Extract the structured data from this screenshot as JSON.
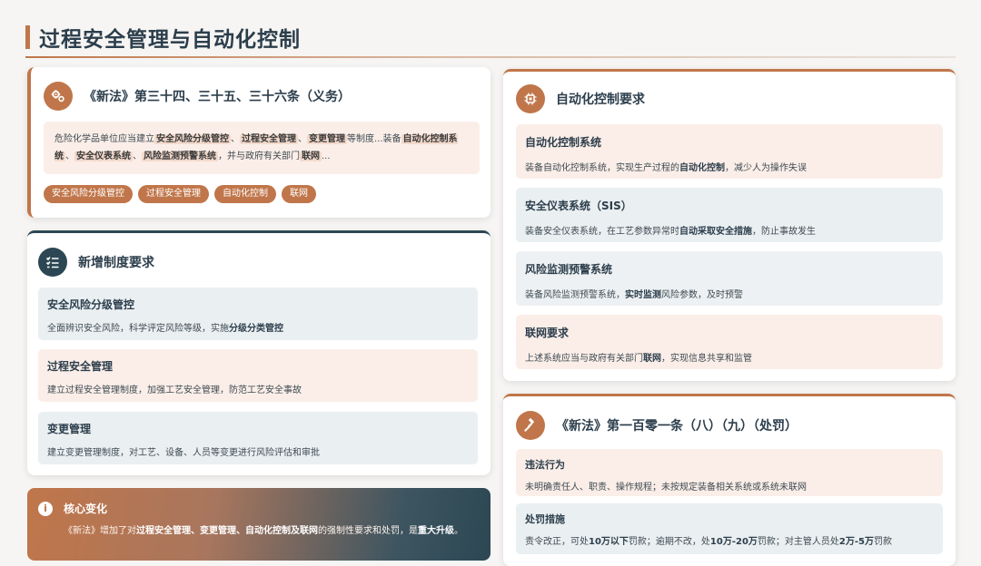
{
  "page": {
    "title": "过程安全管理与自动化控制"
  },
  "card_law": {
    "title": "《新法》第三十四、三十五、三十六条（义务）",
    "text_parts": [
      {
        "t": "危险化学品单位应当建立",
        "hl": false
      },
      {
        "t": "安全风险分级管控",
        "hl": true
      },
      {
        "t": "、",
        "hl": false
      },
      {
        "t": "过程安全管理",
        "hl": true
      },
      {
        "t": "、",
        "hl": false
      },
      {
        "t": "变更管理",
        "hl": true
      },
      {
        "t": "等制度...装备",
        "hl": false
      },
      {
        "t": "自动化控制系统",
        "hl": true
      },
      {
        "t": "、",
        "hl": false
      },
      {
        "t": "安全仪表系统",
        "hl": true
      },
      {
        "t": "、",
        "hl": false
      },
      {
        "t": "风险监测预警系统",
        "hl": true
      },
      {
        "t": "，并与政府有关部门",
        "hl": false
      },
      {
        "t": "联网",
        "hl": true
      },
      {
        "t": "...",
        "hl": false
      }
    ],
    "tags": [
      "安全风险分级管控",
      "过程安全管理",
      "自动化控制",
      "联网"
    ]
  },
  "card_new": {
    "title": "新增制度要求",
    "items": [
      {
        "title": "安全风险分级管控",
        "desc_pre": "全面辨识安全风险，科学评定风险等级，实施",
        "desc_bold": "分级分类管控",
        "desc_post": ""
      },
      {
        "title": "过程安全管理",
        "desc_pre": "建立过程安全管理制度，加强工艺安全管理，防范工艺安全事故",
        "desc_bold": "",
        "desc_post": ""
      },
      {
        "title": "变更管理",
        "desc_pre": "建立变更管理制度，对工艺、设备、人员等变更进行风险评估和审批",
        "desc_bold": "",
        "desc_post": ""
      }
    ]
  },
  "card_core": {
    "title": "核心变化",
    "text_pre": "《新法》增加了对",
    "text_bold": "过程安全管理、变更管理、自动化控制及联网",
    "text_mid": "的强制性要求和处罚，是",
    "text_bold2": "重大升级",
    "text_post": "。"
  },
  "card_auto": {
    "title": "自动化控制要求",
    "items": [
      {
        "title": "自动化控制系统",
        "desc_pre": "装备自动化控制系统，实现生产过程的",
        "desc_bold": "自动化控制",
        "desc_post": "，减少人为操作失误"
      },
      {
        "title": "安全仪表系统（SIS）",
        "desc_pre": "装备安全仪表系统，在工艺参数异常时",
        "desc_bold": "自动采取安全措施",
        "desc_post": "，防止事故发生"
      },
      {
        "title": "风险监测预警系统",
        "desc_pre": "装备风险监测预警系统，",
        "desc_bold": "实时监测",
        "desc_post": "风险参数，及时预警"
      },
      {
        "title": "联网要求",
        "desc_pre": "上述系统应当与政府有关部门",
        "desc_bold": "联网",
        "desc_post": "，实现信息共享和监管"
      }
    ]
  },
  "card_penalty": {
    "title": "《新法》第一百零一条（八）（九）（处罚）",
    "items": [
      {
        "title": "违法行为",
        "desc_pre": "未明确责任人、职责、操作规程；未按规定装备相关系统或系统未联网",
        "desc_bold": "",
        "desc_post": ""
      },
      {
        "title": "处罚措施",
        "desc_pre": "责令改正，可处",
        "desc_bold": "10万以下",
        "desc_post": "罚款；逾期不改，处",
        "desc_bold2": "10万-20万",
        "desc_post2": "罚款；对主管人员处",
        "desc_bold3": "2万-5万",
        "desc_post3": "罚款"
      }
    ]
  },
  "colors": {
    "accent": "#c0764a",
    "dark": "#2c4753",
    "pink_bg": "#fbeee8",
    "blue_bg": "#eaeff1"
  },
  "icons": {
    "law": "gears-icon",
    "new": "list-check-icon",
    "core": "info-icon",
    "auto": "chip-icon",
    "penalty": "gavel-icon"
  }
}
